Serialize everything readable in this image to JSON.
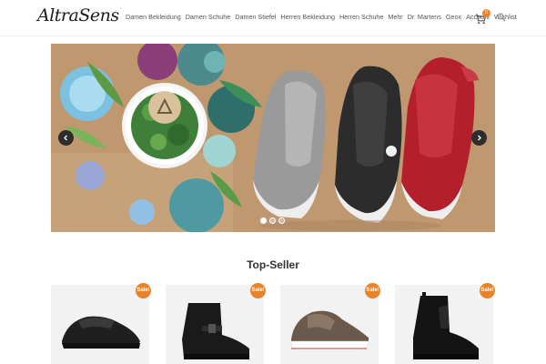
{
  "header": {
    "logo": "AltraSens",
    "nav": [
      {
        "label": "Damen Bekleidung"
      },
      {
        "label": "Damen Schuhe"
      },
      {
        "label": "Damen Stiefel"
      },
      {
        "label": "Herren Bekleidung"
      },
      {
        "label": "Herren Schuhe"
      },
      {
        "label": "Mehr"
      },
      {
        "label": "Dr. Martens"
      },
      {
        "label": "Geox"
      },
      {
        "label": "Account"
      },
      {
        "label": "Wishlist"
      }
    ],
    "cart_count": "0",
    "cart_icon": "cart-icon",
    "search_icon": "search-icon"
  },
  "slider": {
    "prev_icon": "chevron-left-icon",
    "next_icon": "chevron-right-icon",
    "dots": 3,
    "active_dot": 0
  },
  "section": {
    "title": "Top-Seller"
  },
  "products": [
    {
      "badge": "Sale!"
    },
    {
      "badge": "Sale!"
    },
    {
      "badge": "Sale!"
    },
    {
      "badge": "Sale!"
    }
  ],
  "colors": {
    "accent": "#e8832a",
    "hero_bg": "#c09a72"
  }
}
